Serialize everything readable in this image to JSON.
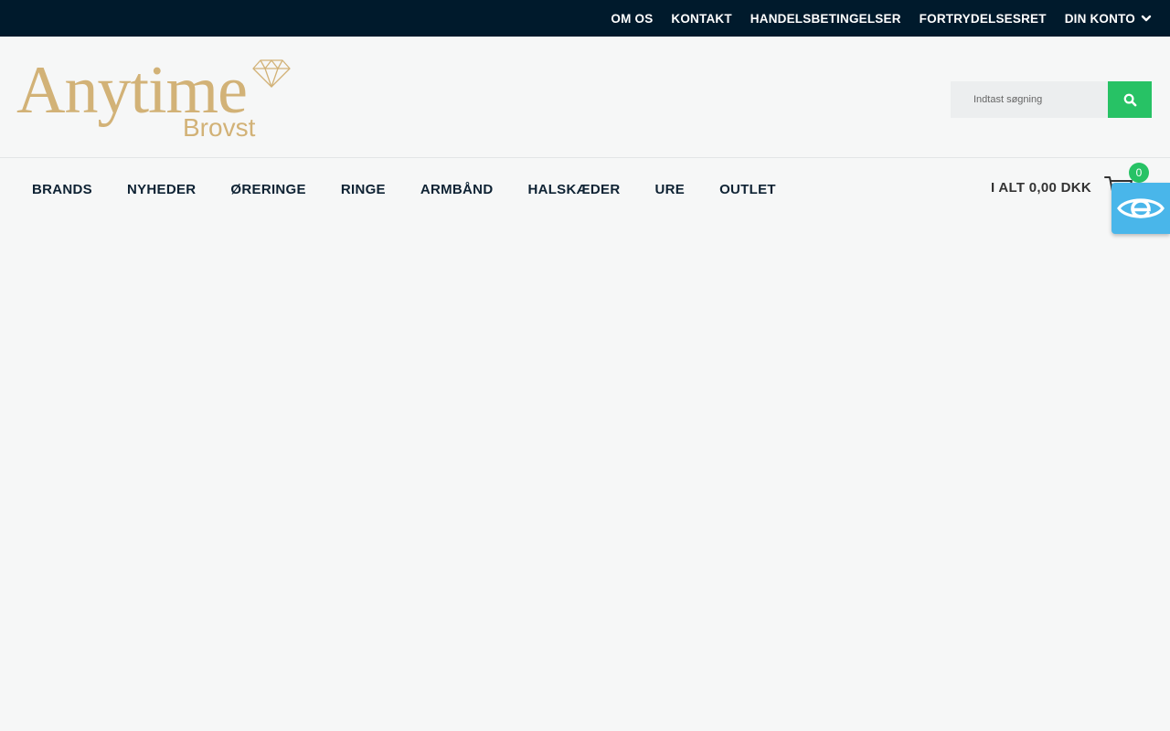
{
  "topnav": {
    "items": [
      "OM OS",
      "KONTAKT",
      "HANDELSBETINGELSER",
      "FORTRYDELSESRET",
      "DIN KONTO"
    ]
  },
  "logo": {
    "word": "Anytime",
    "sub": "Brovst"
  },
  "search": {
    "placeholder": "Indtast søgning",
    "icon": "search-icon"
  },
  "mainnav": {
    "items": [
      "BRANDS",
      "NYHEDER",
      "ØRERINGE",
      "RINGE",
      "ARMBÅND",
      "HALSKÆDER",
      "URE",
      "OUTLET"
    ]
  },
  "cart": {
    "total_label": "I ALT 0,00 DKK",
    "count": "0",
    "icon": "cart-icon"
  },
  "accessibility": {
    "icon": "eye-icon"
  },
  "colors": {
    "topbar": "#001a2c",
    "accent": "#27c265",
    "logo": "#d2b277",
    "widget": "#49b6ea"
  }
}
